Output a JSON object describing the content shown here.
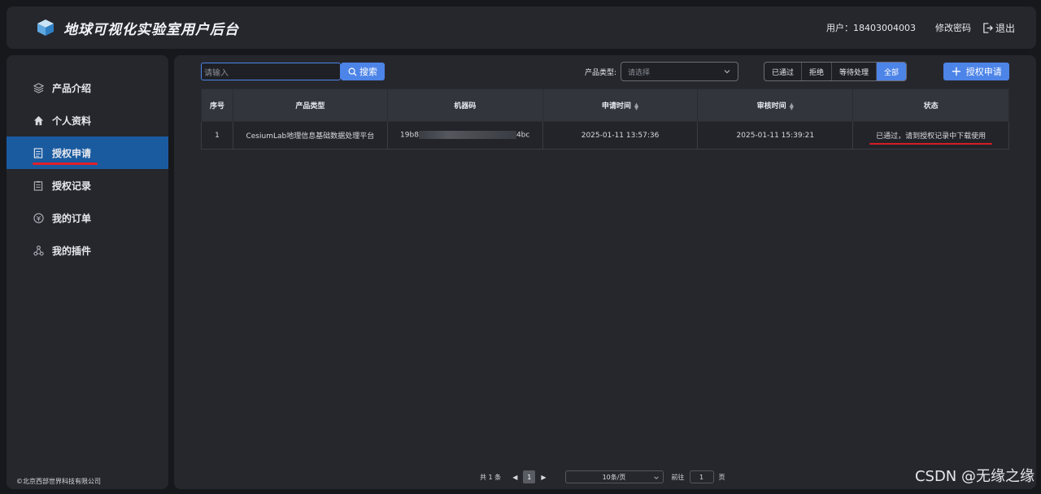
{
  "header": {
    "title": "地球可视化实验室用户后台",
    "user": "用户：18403004003",
    "change_password": "修改密码",
    "logout": "退出"
  },
  "sidebar": {
    "items": [
      {
        "label": "产品介绍",
        "icon": "layers-icon",
        "active": false
      },
      {
        "label": "个人资料",
        "icon": "home-icon",
        "active": false
      },
      {
        "label": "授权申请",
        "icon": "document-icon",
        "active": true
      },
      {
        "label": "授权记录",
        "icon": "clipboard-icon",
        "active": false
      },
      {
        "label": "我的订单",
        "icon": "coin-icon",
        "active": false
      },
      {
        "label": "我的插件",
        "icon": "plugin-icon",
        "active": false
      }
    ],
    "copyright": "©北京西部世界科技有限公司"
  },
  "toolbar": {
    "search_placeholder": "请输入",
    "search_label": "搜索",
    "product_type_label": "产品类型:",
    "product_type_placeholder": "请选择",
    "filters": [
      "已通过",
      "拒绝",
      "等待处理",
      "全部"
    ],
    "active_filter": "全部",
    "apply_label": "授权申请"
  },
  "table": {
    "columns": [
      "序号",
      "产品类型",
      "机器码",
      "申请时间",
      "审核时间",
      "状态"
    ],
    "rows": [
      {
        "index": "1",
        "product": "CesiumLab地理信息基础数据处理平台",
        "machine_prefix": "19b8",
        "machine_suffix": "4bc",
        "apply_time": "2025-01-11 13:57:36",
        "review_time": "2025-01-11 15:39:21",
        "status": "已通过，请到授权记录中下载使用"
      }
    ]
  },
  "pagination": {
    "total": "共 1 条",
    "current_page": "1",
    "page_size": "10条/页",
    "goto_label": "前往",
    "goto_value": "1",
    "page_unit": "页"
  },
  "watermark": "CSDN @无缘之缘",
  "colors": {
    "accent": "#4d84e8",
    "active_nav": "#1a5ba0",
    "status_success": "#3fdb3f",
    "annotation_red": "#e0202a"
  }
}
